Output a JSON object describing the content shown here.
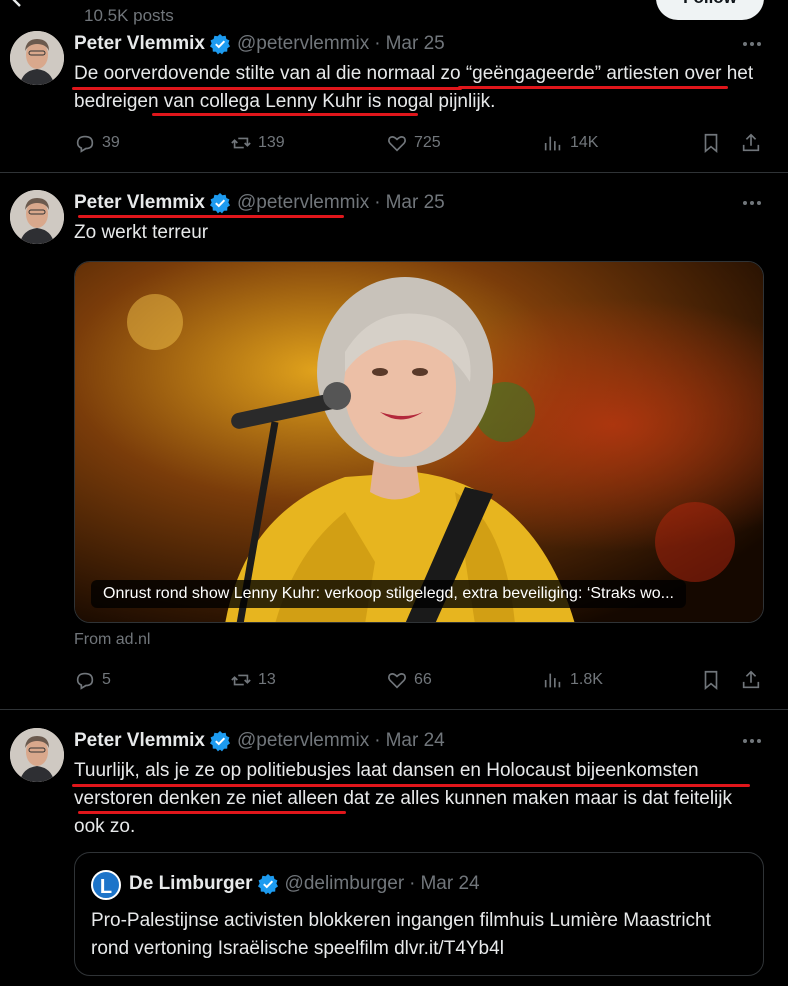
{
  "header": {
    "post_count": "10.5K posts",
    "follow_label": "Follow"
  },
  "tweets": [
    {
      "author": "Peter Vlemmix",
      "handle": "@petervlemmix",
      "separator": "·",
      "date": "Mar 25",
      "text": "De oorverdovende stilte van al die normaal zo “geëngageerde” artiesten over het bedreigen van collega Lenny Kuhr is nogal pijnlijk.",
      "replies": "39",
      "reposts": "139",
      "likes": "725",
      "views": "14K"
    },
    {
      "author": "Peter Vlemmix",
      "handle": "@petervlemmix",
      "separator": "·",
      "date": "Mar 25",
      "text": "Zo werkt terreur",
      "media_caption": "Onrust rond show Lenny Kuhr: verkoop stilgelegd, extra beveiliging: ‘Straks wo...",
      "media_source": "From ad.nl",
      "replies": "5",
      "reposts": "13",
      "likes": "66",
      "views": "1.8K"
    },
    {
      "author": "Peter Vlemmix",
      "handle": "@petervlemmix",
      "separator": "·",
      "date": "Mar 24",
      "text": "Tuurlijk, als je ze op politiebusjes laat dansen en Holocaust bijeenkomsten verstoren denken ze niet alleen dat ze alles kunnen maken maar is dat feitelijk ook zo.",
      "quote": {
        "avatar_letter": "L",
        "author": "De Limburger",
        "handle": "@delimburger",
        "separator": "·",
        "date": "Mar 24",
        "text": "Pro-Palestijnse activisten blokkeren ingangen filmhuis Lumière Maastricht rond vertoning Israëlische speelfilm dlvr.it/T4Yb4l"
      }
    }
  ],
  "colors": {
    "background": "#000000",
    "text": "#e7e9ea",
    "muted": "#71767b",
    "border": "#2f3336",
    "verified": "#1d9bf0",
    "annotation": "#e0161b"
  },
  "icons": [
    "back-arrow-icon",
    "more-icon",
    "reply-icon",
    "repost-icon",
    "like-icon",
    "views-icon",
    "bookmark-icon",
    "share-icon",
    "verified-badge-icon"
  ]
}
